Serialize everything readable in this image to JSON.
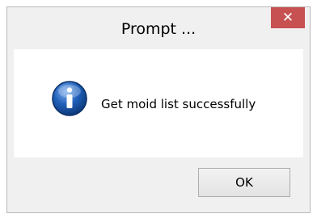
{
  "dialog": {
    "title": "Prompt ...",
    "close_label": "✕",
    "icon": "info-icon",
    "message": "Get moid list successfully",
    "ok_label": "OK"
  },
  "colors": {
    "close_button": "#c75050",
    "icon_blue": "#1f5fb8",
    "frame_background": "#f0f0f0",
    "content_background": "#ffffff"
  }
}
